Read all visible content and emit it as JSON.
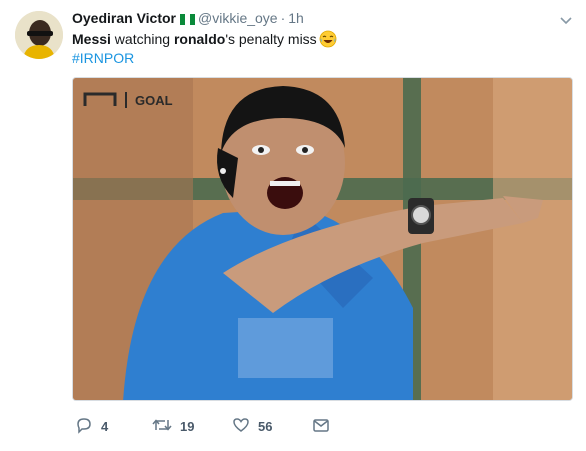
{
  "tweet": {
    "author": {
      "display_name": "Oyediran Victor",
      "handle": "@vikkie_oye",
      "flag_icon": "nigeria-flag-icon"
    },
    "separator": "·",
    "timestamp": "1h",
    "text": {
      "part1": "Messi",
      "part2": " watching ",
      "part3": "ronaldo",
      "part4": "'s penalty miss",
      "emoji": "face-with-tears-of-joy"
    },
    "hashtag": "#IRNPOR",
    "media": {
      "watermark": "GOAL"
    },
    "actions": {
      "reply_count": "4",
      "retweet_count": "19",
      "like_count": "56"
    }
  },
  "colors": {
    "link": "#1b95e0",
    "muted": "#657786",
    "shirt": "#2f7fd0"
  }
}
